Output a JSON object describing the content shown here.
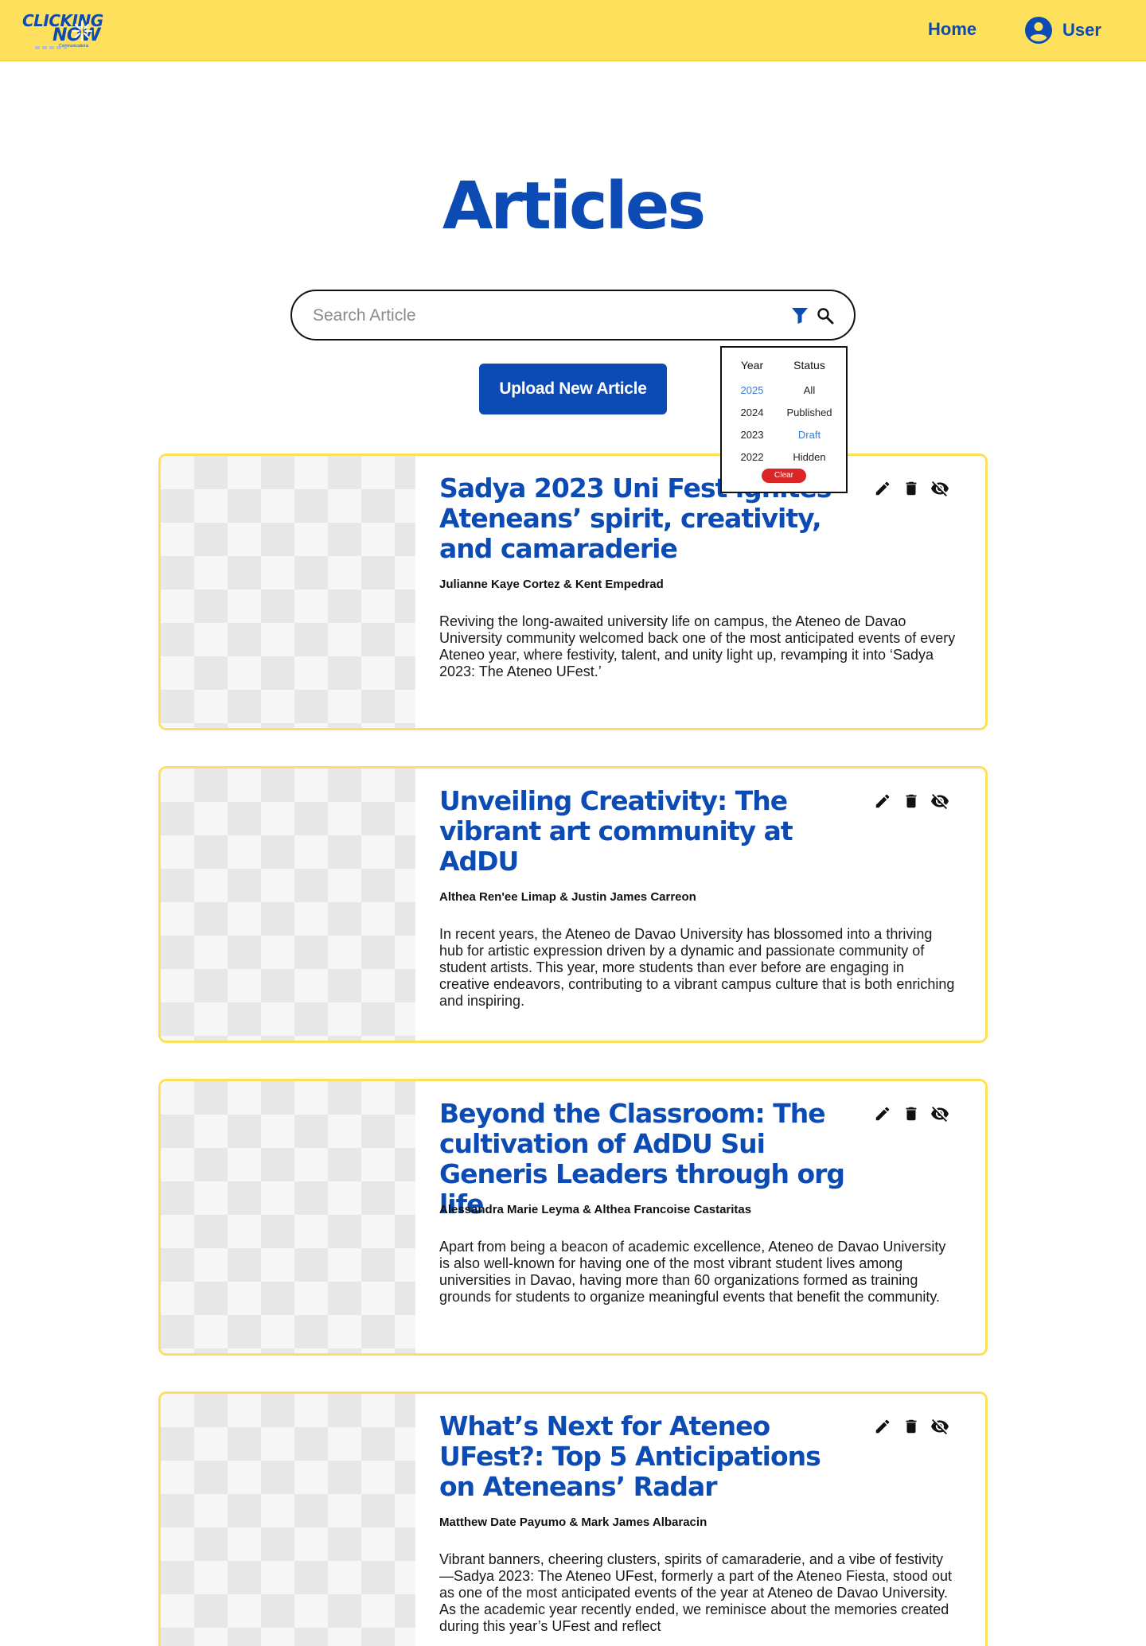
{
  "header": {
    "logo_line1": "CLICKING",
    "logo_line2": "NOW",
    "logo_sub": "Communications",
    "nav_home": "Home",
    "nav_user": "User",
    "brand_color": "#0b4bb3",
    "bar_color": "#ffe05c"
  },
  "page": {
    "title": "Articles"
  },
  "search": {
    "placeholder": "Search Article",
    "value": ""
  },
  "upload_button": "Upload New Article",
  "filter": {
    "year_heading": "Year",
    "status_heading": "Status",
    "years": [
      "2025",
      "2024",
      "2023",
      "2022"
    ],
    "statuses": [
      "All",
      "Published",
      "Draft",
      "Hidden"
    ],
    "selected_year": "2025",
    "selected_status": "Draft",
    "clear_label": "Clear"
  },
  "articles": [
    {
      "title": "Sadya 2023 Uni Fest ignites Ateneans’ spirit, creativity, and camaraderie",
      "authors": "Julianne Kaye Cortez & Kent Empedrad",
      "summary": "Reviving the long-awaited university life on campus, the Ateneo de Davao University community welcomed back one of the most anticipated events of every Ateneo year, where festivity, talent, and unity light up, revamping it into ‘Sadya 2023: The Ateneo UFest.’"
    },
    {
      "title": "Unveiling Creativity: The vibrant art community at AdDU",
      "authors": "Althea Ren'ee Limap & Justin James Carreon",
      "summary": "In recent years, the Ateneo de Davao University has blossomed into a thriving hub for artistic expression driven by a dynamic and passionate community of student artists. This year, more students than ever before are engaging in creative endeavors, contributing to a vibrant campus culture that is both enriching and inspiring."
    },
    {
      "title": "Beyond the Classroom: The cultivation of AdDU Sui Generis Leaders through org life",
      "authors": "Alessandra Marie Leyma & Althea Francoise Castaritas",
      "summary": "Apart from being a beacon of academic excellence, Ateneo de Davao University is also well-known for having one of the most vibrant student lives among universities in Davao, having more than 60 organizations formed as training grounds for students to organize meaningful events that benefit the community."
    },
    {
      "title": "What’s Next for Ateneo UFest?: Top 5 Anticipations on Ateneans’ Radar",
      "authors": "Matthew Date Payumo & Mark James Albaracin",
      "summary": "Vibrant banners, cheering clusters, spirits of camaraderie, and a vibe of festivity—Sadya 2023: The Ateneo UFest, formerly a part of the Ateneo Fiesta, stood out as one of the most anticipated events of the year at Ateneo de Davao University. As the academic year recently ended, we reminisce about the memories created during this year’s UFest and reflect"
    }
  ],
  "icons": {
    "edit": "pencil-icon",
    "delete": "trash-icon",
    "hide": "eye-off-icon",
    "filter": "funnel-icon",
    "search": "magnifier-icon",
    "user": "account-circle-icon"
  }
}
